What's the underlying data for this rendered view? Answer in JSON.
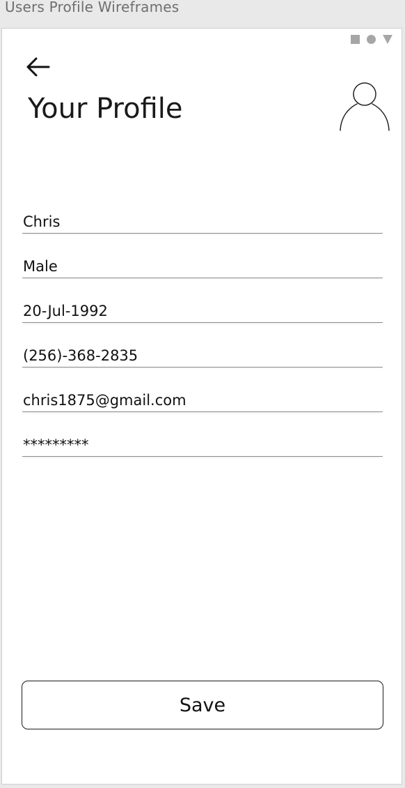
{
  "window": {
    "title": "Users Profile Wireframes"
  },
  "status_bar": {
    "icons": [
      "square-icon",
      "circle-icon",
      "triangle-icon"
    ],
    "color": "#a6a6a6"
  },
  "header": {
    "back_icon": "arrow-left-icon",
    "title": "Your Profile",
    "avatar_icon": "user-avatar-icon"
  },
  "form": {
    "name": {
      "value": "Chris"
    },
    "gender": {
      "value": "Male"
    },
    "birth_date": {
      "value": "20-Jul-1992"
    },
    "phone": {
      "value": "(256)-368-2835"
    },
    "email": {
      "value": "chris1875@gmail.com"
    },
    "password": {
      "value": "*********"
    }
  },
  "actions": {
    "save_label": "Save"
  }
}
